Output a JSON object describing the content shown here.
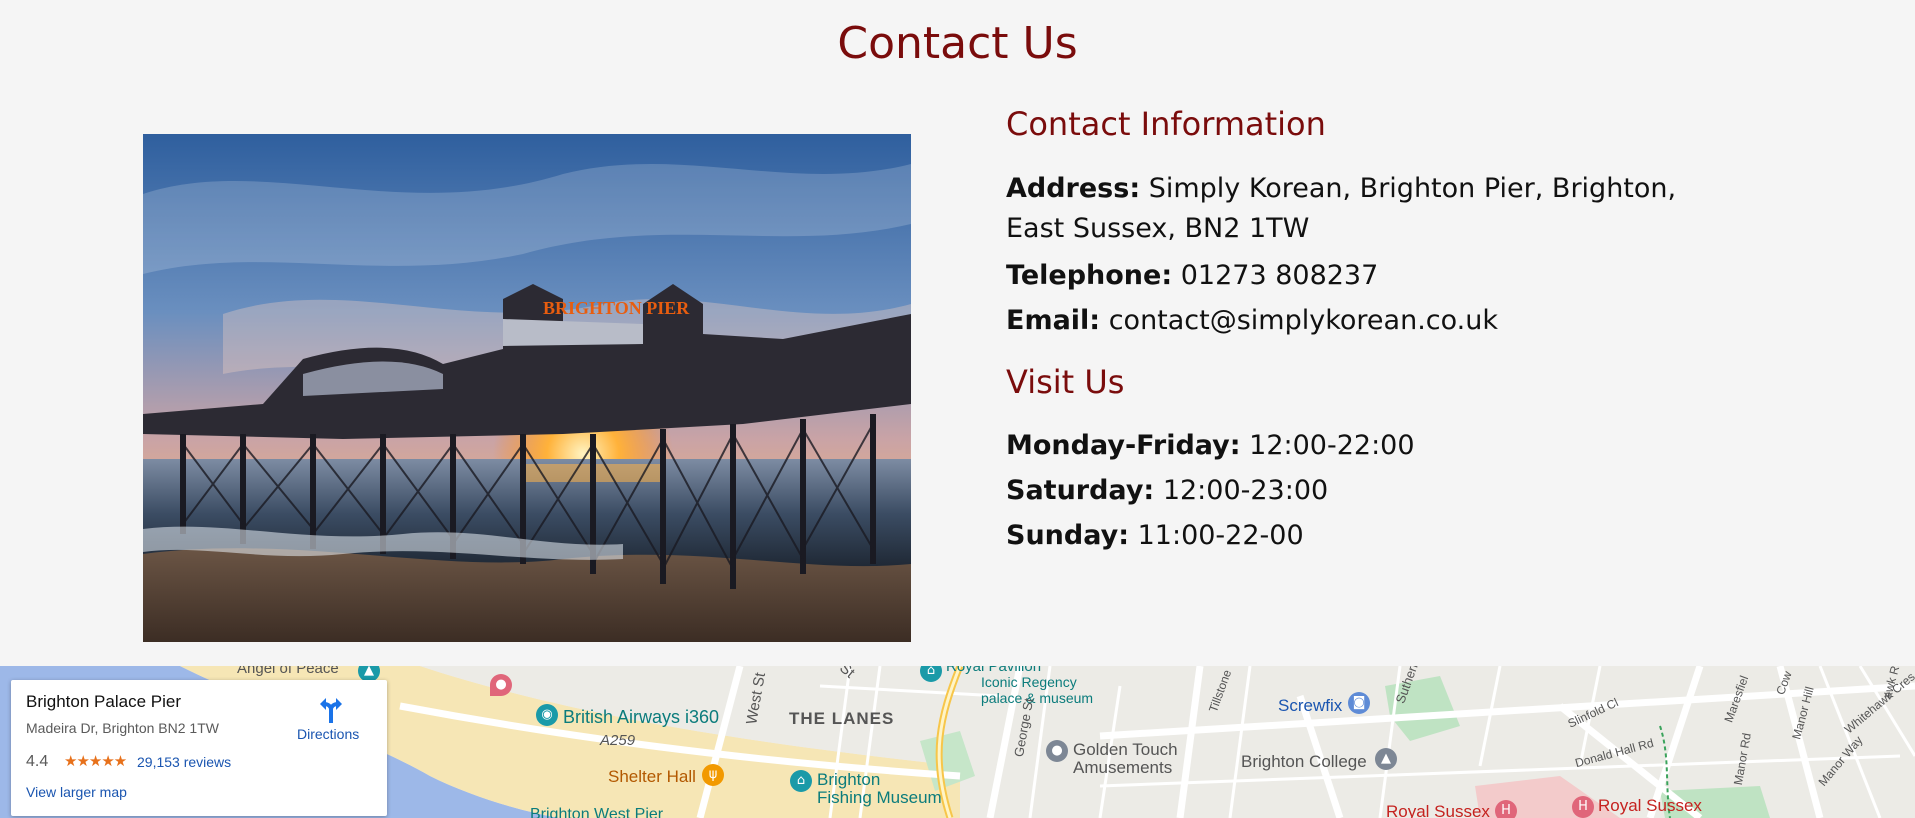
{
  "page": {
    "title": "Contact Us"
  },
  "contact": {
    "heading": "Contact Information",
    "address_label": "Address:",
    "address_value": "Simply Korean, Brighton Pier, Brighton, East Sussex, BN2 1TW",
    "telephone_label": "Telephone:",
    "telephone_value": "01273 808237",
    "email_label": "Email:",
    "email_value": "contact@simplykorean.co.uk"
  },
  "visit": {
    "heading": "Visit Us",
    "hours": [
      {
        "label": "Monday-Friday:",
        "value": "12:00-22:00"
      },
      {
        "label": "Saturday:",
        "value": "12:00-23:00"
      },
      {
        "label": "Sunday:",
        "value": "11:00-22-00"
      }
    ]
  },
  "photo": {
    "sign_text": "BRIGHTON PIER"
  },
  "map": {
    "card": {
      "place_name": "Brighton Palace Pier",
      "address": "Madeira Dr, Brighton BN2 1TW",
      "rating": "4.4",
      "stars": "★★★★★",
      "reviews": "29,153 reviews",
      "directions_label": "Directions",
      "larger_map_label": "View larger map"
    },
    "labels": {
      "angel_of_peace": "Angel of Peace",
      "british_airways": "British Airways i360",
      "a259": "A259",
      "west_st": "West St",
      "the_lanes": "THE LANES",
      "shelter_hall": "Shelter Hall",
      "fishing_museum_1": "Brighton",
      "fishing_museum_2": "Fishing Museum",
      "royal_pavilion_1": "Royal Pavilion",
      "royal_pavilion_2": "Iconic Regency",
      "royal_pavilion_3": "palace & museum",
      "george_st": "George St",
      "golden_touch_1": "Golden Touch",
      "golden_touch_2": "Amusements",
      "screwfix": "Screwfix",
      "brighton_college": "Brighton College",
      "tillstone": "Tillstone",
      "sutherland": "Sutherl",
      "slinfold_cl": "Slinfold Cl",
      "donald_hall_rd": "Donald Hall Rd",
      "manor_rd": "Manor Rd",
      "manor_hill": "Manor Hill",
      "manor_way": "Manor Way",
      "whitehawk_cres": "Whitehawk Cres",
      "royal_sussex_1": "Royal Sussex",
      "royal_sussex_2": "Royal Sussex",
      "west_pier": "Brighton West Pier",
      "st_label": "St",
      "maresfield": "Maresfiel",
      "cow": "Cow",
      "hawk_rd": "awk Rd"
    }
  },
  "colors": {
    "heading": "#7a0c0c",
    "background": "#f5f5f5",
    "link": "#1a55b0",
    "star": "#e7711b"
  }
}
